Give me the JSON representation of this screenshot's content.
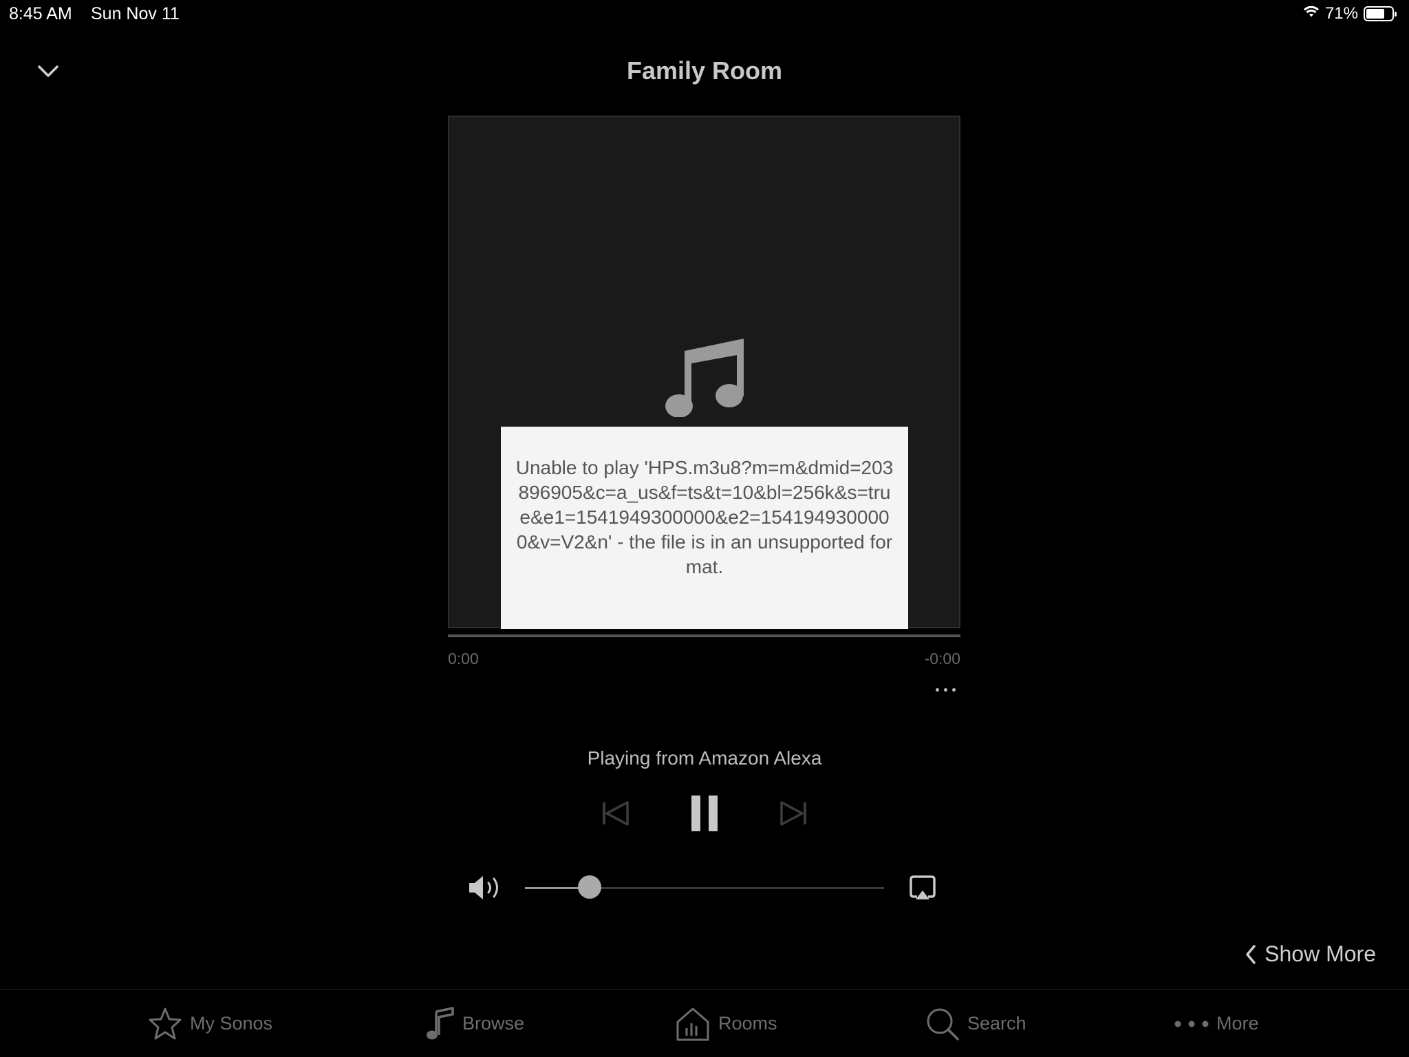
{
  "status_bar": {
    "time": "8:45 AM",
    "date": "Sun Nov 11",
    "battery": "71%",
    "battery_level": 0.71,
    "wifi_icon": "wifi-icon"
  },
  "header": {
    "title": "Family Room",
    "collapse_icon": "chevron-down-icon"
  },
  "artwork": {
    "placeholder_icon": "music-note-icon",
    "error_message": "Unable to play 'HPS.m3u8?m=m&dmid=203896905&c=a_us&f=ts&t=10&bl=256k&s=true&e1=1541949300000&e2=1541949300000&v=V2&n' - the file is in an unsupported format."
  },
  "progress": {
    "elapsed": "0:00",
    "remaining": "-0:00",
    "fraction": 0.0
  },
  "source": {
    "text": "Playing from Amazon Alexa"
  },
  "transport": {
    "prev_icon": "skip-back-icon",
    "pause_icon": "pause-icon",
    "next_icon": "skip-forward-icon"
  },
  "volume": {
    "level": 0.18,
    "icon": "speaker-icon",
    "airplay_icon": "airplay-icon"
  },
  "show_more": {
    "label": "Show More"
  },
  "bottom_nav": {
    "items": [
      {
        "label": "My Sonos",
        "icon": "star-icon"
      },
      {
        "label": "Browse",
        "icon": "music-note-icon"
      },
      {
        "label": "Rooms",
        "icon": "house-icon"
      },
      {
        "label": "Search",
        "icon": "search-icon"
      },
      {
        "label": "More",
        "icon": "more-dots-icon"
      }
    ]
  },
  "colors": {
    "background": "#000000",
    "artwork_bg": "#1a1a1a",
    "error_bg": "#f4f4f4",
    "text_muted": "#6d6d6d"
  }
}
